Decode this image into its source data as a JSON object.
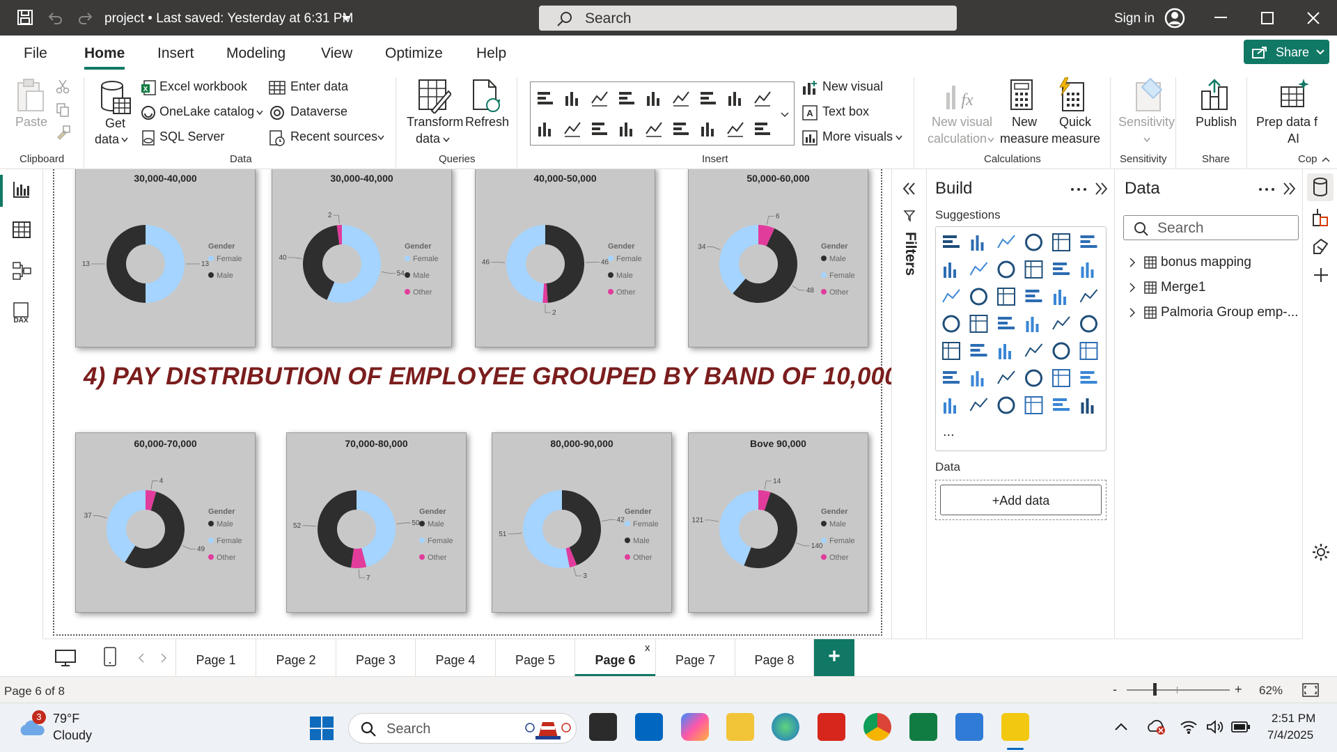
{
  "titlebar": {
    "title": "project • Last saved: Yesterday at 6:31 PM",
    "search_placeholder": "Search",
    "signin": "Sign in"
  },
  "menu": {
    "items": [
      "File",
      "Home",
      "Insert",
      "Modeling",
      "View",
      "Optimize",
      "Help"
    ],
    "active": "Home",
    "share": "Share"
  },
  "ribbon": {
    "clipboard": {
      "paste": "Paste",
      "group": "Clipboard"
    },
    "data": {
      "get_data": "Get",
      "get_data2": "data",
      "excel": "Excel workbook",
      "onelake": "OneLake catalog",
      "sql": "SQL Server",
      "enter": "Enter data",
      "dataverse": "Dataverse",
      "recent": "Recent sources",
      "group": "Data"
    },
    "queries": {
      "transform": "Transform",
      "transform2": "data",
      "refresh": "Refresh",
      "group": "Queries"
    },
    "insert": {
      "new_visual": "New visual",
      "text_box": "Text box",
      "more_visuals": "More visuals",
      "group": "Insert"
    },
    "calculations": {
      "new_visual_calc": "New visual",
      "new_visual_calc2": "calculation",
      "new_measure": "New",
      "new_measure2": "measure",
      "quick_measure": "Quick",
      "quick_measure2": "measure",
      "group": "Calculations"
    },
    "sensitivity": {
      "label": "Sensitivity",
      "group": "Sensitivity"
    },
    "share": {
      "publish": "Publish",
      "group": "Share"
    },
    "copilot": {
      "prep": "Prep data f",
      "prep2": "AI",
      "group": "Cop"
    }
  },
  "canvas": {
    "headline": "4) PAY DISTRIBUTION OF EMPLOYEE GROUPED BY BAND OF 10,000",
    "legend_title": "Gender",
    "colors": {
      "Female": "#a4d4ff",
      "Male": "#2e2e2e",
      "Other": "#e13c9c"
    },
    "charts": [
      {
        "title": "30,000-40,000",
        "legend": [
          "Female",
          "Male"
        ],
        "slices": [
          {
            "label": "Female",
            "value": 13
          },
          {
            "label": "Male",
            "value": 13
          }
        ]
      },
      {
        "title": "30,000-40,000",
        "legend": [
          "Female",
          "Male",
          "Other"
        ],
        "slices": [
          {
            "label": "Female",
            "value": 54
          },
          {
            "label": "Male",
            "value": 40
          },
          {
            "label": "Other",
            "value": 2
          }
        ]
      },
      {
        "title": "40,000-50,000",
        "legend": [
          "Female",
          "Male",
          "Other"
        ],
        "slices": [
          {
            "label": "Male",
            "value": 46
          },
          {
            "label": "Other",
            "value": 2
          },
          {
            "label": "Female",
            "value": 46
          }
        ]
      },
      {
        "title": "50,000-60,000",
        "legend": [
          "Male",
          "Female",
          "Other"
        ],
        "slices": [
          {
            "label": "Other",
            "value": 6
          },
          {
            "label": "Male",
            "value": 48
          },
          {
            "label": "Female",
            "value": 34
          }
        ]
      },
      {
        "title": "60,000-70,000",
        "legend": [
          "Male",
          "Female",
          "Other"
        ],
        "slices": [
          {
            "label": "Other",
            "value": 4
          },
          {
            "label": "Male",
            "value": 49
          },
          {
            "label": "Female",
            "value": 37
          }
        ]
      },
      {
        "title": "70,000-80,000",
        "legend": [
          "Male",
          "Female",
          "Other"
        ],
        "slices": [
          {
            "label": "Female",
            "value": 50
          },
          {
            "label": "Other",
            "value": 7
          },
          {
            "label": "Male",
            "value": 52
          }
        ]
      },
      {
        "title": "80,000-90,000",
        "legend": [
          "Female",
          "Male",
          "Other"
        ],
        "slices": [
          {
            "label": "Male",
            "value": 42
          },
          {
            "label": "Other",
            "value": 3
          },
          {
            "label": "Female",
            "value": 51
          }
        ]
      },
      {
        "title": "Bove 90,000",
        "legend": [
          "Male",
          "Female",
          "Other"
        ],
        "slices": [
          {
            "label": "Other",
            "value": 14
          },
          {
            "label": "Male",
            "value": 140
          },
          {
            "label": "Female",
            "value": 121
          }
        ]
      }
    ]
  },
  "filters": {
    "label": "Filters"
  },
  "build": {
    "title": "Build",
    "suggestions": "Suggestions",
    "data_label": "Data",
    "add_data": "+Add data",
    "more": "..."
  },
  "data_panel": {
    "title": "Data",
    "search_placeholder": "Search",
    "items": [
      "bonus mapping",
      "Merge1",
      "Palmoria Group emp-..."
    ]
  },
  "pages": {
    "tabs": [
      "Page 1",
      "Page 2",
      "Page 3",
      "Page 4",
      "Page 5",
      "Page 6",
      "Page 7",
      "Page 8"
    ],
    "active": "Page 6",
    "add": "+",
    "close": "x"
  },
  "status": {
    "page_info": "Page 6 of 8",
    "zoom": "62%",
    "minus": "-",
    "plus": "+"
  },
  "taskbar": {
    "weather_temp": "79°F",
    "weather_desc": "Cloudy",
    "weather_badge": "3",
    "search": "Search",
    "time": "2:51 PM",
    "date": "7/4/2025"
  }
}
